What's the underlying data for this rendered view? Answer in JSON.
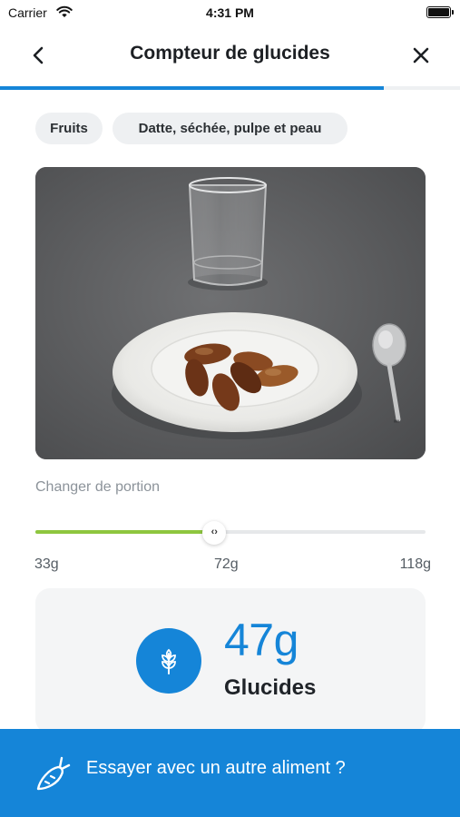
{
  "status_bar": {
    "carrier": "Carrier",
    "time": "4:31 PM",
    "wifi_icon": "wifi-icon",
    "battery_icon": "battery-icon"
  },
  "header": {
    "title": "Compteur de glucides",
    "back_icon": "chevron-left-icon",
    "close_icon": "close-icon",
    "progress_fraction": 0.835,
    "progress_color": "#1585d8"
  },
  "chips": {
    "category": "Fruits",
    "food": "Datte, séchée, pulpe et peau"
  },
  "photo": {
    "content": "photo-of-dates-on-plate-with-glass-and-spoon"
  },
  "portion": {
    "label": "Changer de portion",
    "min_label": "33g",
    "current_label": "72g",
    "max_label": "118g",
    "min_value": 33,
    "current_value": 72,
    "max_value": 118,
    "thumb_glyph": "‹›",
    "track_fill_color": "#8ec63f"
  },
  "result": {
    "icon": "grain-icon",
    "value": "47g",
    "label": "Glucides",
    "accent_color": "#1585d8"
  },
  "footer": {
    "icon": "carrot-icon",
    "label": "Essayer avec un autre aliment ?"
  }
}
